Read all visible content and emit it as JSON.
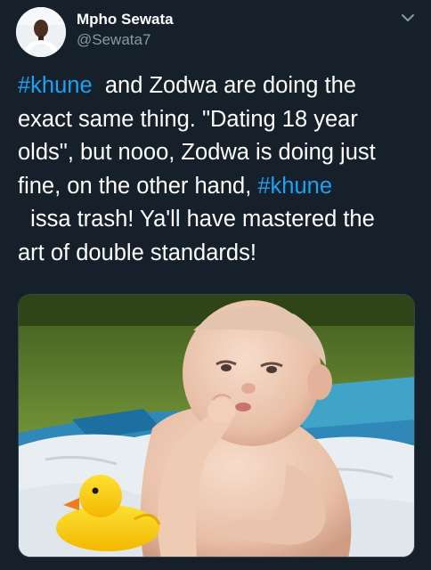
{
  "author": {
    "display_name": "Mpho Sewata",
    "handle": "@Sewata7"
  },
  "icons": {
    "menu": "chevron-down-icon",
    "avatar": "avatar"
  },
  "tweet": {
    "lines": [
      {
        "hashtag": "#khune",
        "after": "  and Zodwa are doing the"
      },
      {
        "text": "exact same thing. \"Dating 18 year"
      },
      {
        "text": "olds\", but nooo, Zodwa is doing just"
      },
      {
        "before": "fine, on the other hand, ",
        "hashtag": "#khune"
      },
      {
        "text": "  issa trash! Ya'll have mastered the"
      },
      {
        "text": "art of double standards!"
      }
    ]
  },
  "media": {
    "content": "photo-baby-and-rubber-duck"
  },
  "colors": {
    "background": "#15202b",
    "name": "#ffffff",
    "handle": "#8899a6",
    "link": "#1da1f2",
    "border": "#38444d"
  }
}
